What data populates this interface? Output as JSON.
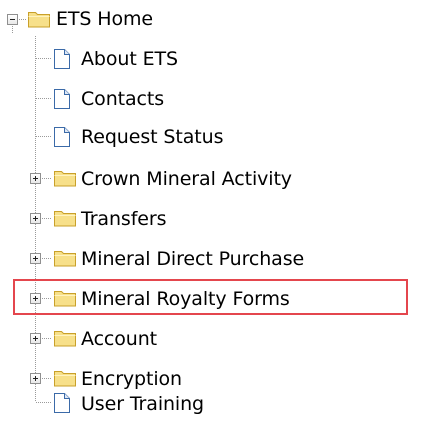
{
  "tree": {
    "root": {
      "label": "ETS Home",
      "icon": "folder-icon",
      "state": "expanded"
    },
    "items": [
      {
        "label": "About ETS",
        "icon": "page-icon",
        "type": "leaf"
      },
      {
        "label": "Contacts",
        "icon": "page-icon",
        "type": "leaf"
      },
      {
        "label": "Request Status",
        "icon": "page-icon",
        "type": "leaf"
      },
      {
        "label": "Crown Mineral Activity",
        "icon": "folder-icon",
        "type": "collapsed-folder"
      },
      {
        "label": "Transfers",
        "icon": "folder-icon",
        "type": "collapsed-folder"
      },
      {
        "label": "Mineral Direct Purchase",
        "icon": "folder-icon",
        "type": "collapsed-folder"
      },
      {
        "label": "Mineral Royalty Forms",
        "icon": "folder-icon",
        "type": "collapsed-folder",
        "highlighted": true
      },
      {
        "label": "Account",
        "icon": "folder-icon",
        "type": "collapsed-folder"
      },
      {
        "label": "Encryption",
        "icon": "folder-icon",
        "type": "collapsed-folder"
      },
      {
        "label": "User Training",
        "icon": "page-icon",
        "type": "leaf"
      }
    ]
  },
  "colors": {
    "highlight_border": "#e4464d",
    "folder_fill": "#f7e08a",
    "folder_stroke": "#c9a02a",
    "page_stroke": "#3b6aa8",
    "tree_line": "#9a9a9a"
  }
}
